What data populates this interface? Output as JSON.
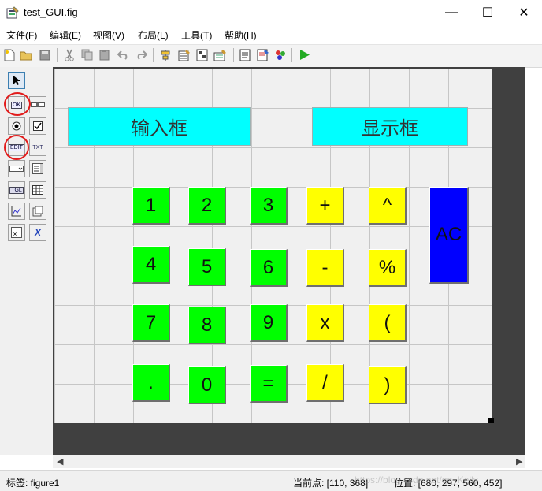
{
  "window": {
    "title": "test_GUI.fig",
    "minimize": "—",
    "maximize": "☐",
    "close": "✕"
  },
  "menu": [
    "文件(F)",
    "编辑(E)",
    "视图(V)",
    "布局(L)",
    "工具(T)",
    "帮助(H)"
  ],
  "palette": {
    "labels": {
      "pushbutton": "OK",
      "edit": "EDIT",
      "text": "TXT",
      "toggle": "TGL",
      "activex": "X"
    }
  },
  "canvas": {
    "input_label": "输入框",
    "display_label": "显示框",
    "keys": {
      "k1": "1",
      "k2": "2",
      "k3": "3",
      "plus": "+",
      "caret": "^",
      "k4": "4",
      "k5": "5",
      "k6": "6",
      "minus": "-",
      "percent": "%",
      "k7": "7",
      "k8": "8",
      "k9": "9",
      "times": "x",
      "lparen": "(",
      "dot": ".",
      "k0": "0",
      "equals": "=",
      "divide": "/",
      "rparen": ")",
      "ac": "AC"
    }
  },
  "status": {
    "tag": "标签: figure1",
    "current_point": "当前点: [110, 368]",
    "position": "位置: [680, 297, 560, 452]",
    "watermark": "https://blog.csdn.net/qq_Kelly"
  },
  "colors": {
    "input_bg": "#00ffff",
    "number_key": "#00ff00",
    "operator_key": "#ffff00",
    "ac_key": "#0000ff",
    "annotation": "#e21b1b"
  }
}
